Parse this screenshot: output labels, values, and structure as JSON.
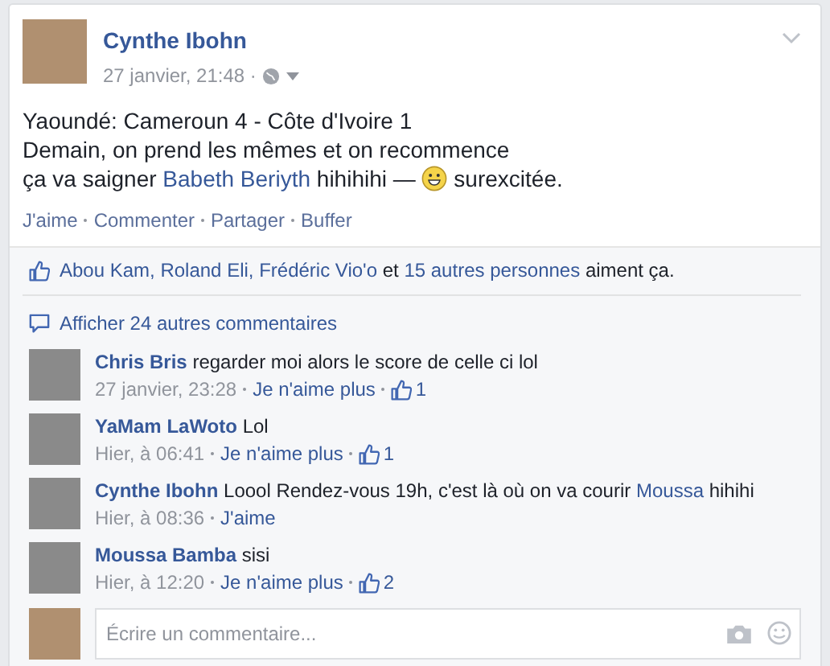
{
  "post": {
    "author": "Cynthe Ibohn",
    "time": "27 janvier, 21:48 ·",
    "lines": [
      [
        {
          "kind": "text",
          "text": "Yaoundé: Cameroun 4 - Côte d'Ivoire 1"
        }
      ],
      [
        {
          "kind": "text",
          "text": "Demain, on prend les mêmes et on recommence"
        }
      ],
      [
        {
          "kind": "text",
          "text": "ça va saigner "
        },
        {
          "kind": "link",
          "text": "Babeth Beriyth"
        },
        {
          "kind": "text",
          "text": " hihihihi — "
        },
        {
          "kind": "emoji"
        },
        {
          "kind": "text",
          "text": " surexcitée."
        }
      ]
    ],
    "actions": [
      "J'aime",
      "Commenter",
      "Partager",
      "Buffer"
    ]
  },
  "likes": [
    {
      "kind": "link",
      "text": "Abou Kam, Roland Eli, Frédéric Vio'o"
    },
    {
      "kind": "text",
      "text": " et "
    },
    {
      "kind": "link",
      "text": "15 autres personnes"
    },
    {
      "kind": "text",
      "text": " aiment ça."
    }
  ],
  "show_more": "Afficher 24 autres commentaires",
  "comments": [
    {
      "author": "Chris Bris",
      "body": [
        {
          "kind": "text",
          "text": "regarder moi alors le score de celle ci lol"
        }
      ],
      "time": "27 janvier, 23:28",
      "action": "Je n'aime plus",
      "like_count": "1"
    },
    {
      "author": "YaMam LaWoto",
      "body": [
        {
          "kind": "text",
          "text": "Lol"
        }
      ],
      "time": "Hier, à 06:41",
      "action": "Je n'aime plus",
      "like_count": "1"
    },
    {
      "author": "Cynthe Ibohn",
      "body": [
        {
          "kind": "text",
          "text": "Loool Rendez-vous 19h, c'est là où on va courir "
        },
        {
          "kind": "link",
          "text": "Moussa"
        },
        {
          "kind": "text",
          "text": " hihihi"
        }
      ],
      "time": "Hier, à 08:36",
      "action": "J'aime"
    },
    {
      "author": "Moussa Bamba",
      "body": [
        {
          "kind": "text",
          "text": "sisi"
        }
      ],
      "time": "Hier, à 12:20",
      "action": "Je n'aime plus",
      "like_count": "2"
    }
  ],
  "comment_box": {
    "placeholder": "Écrire un commentaire..."
  }
}
